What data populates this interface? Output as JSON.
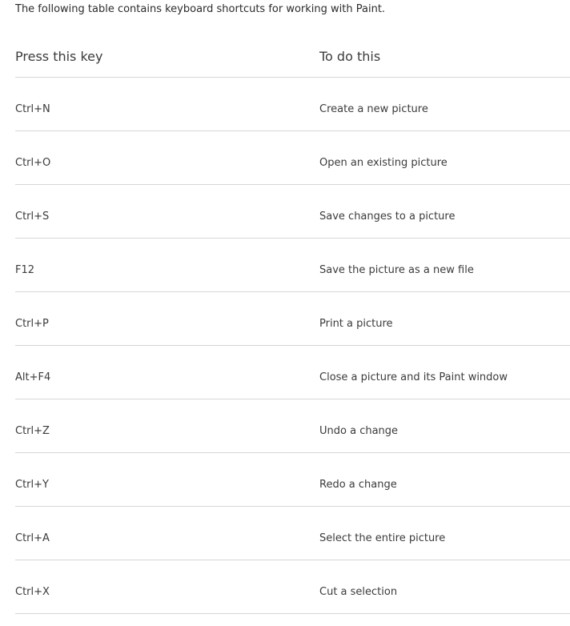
{
  "intro": "The following table contains keyboard shortcuts for working with Paint.",
  "table": {
    "headers": {
      "key": "Press this key",
      "action": "To do this"
    },
    "rows": [
      {
        "key": "Ctrl+N",
        "action": "Create a new picture"
      },
      {
        "key": "Ctrl+O",
        "action": "Open an existing picture"
      },
      {
        "key": "Ctrl+S",
        "action": "Save changes to a picture"
      },
      {
        "key": "F12",
        "action": "Save the picture as a new file"
      },
      {
        "key": "Ctrl+P",
        "action": "Print a picture"
      },
      {
        "key": "Alt+F4",
        "action": "Close a picture and its Paint window"
      },
      {
        "key": "Ctrl+Z",
        "action": "Undo a change"
      },
      {
        "key": "Ctrl+Y",
        "action": "Redo a change"
      },
      {
        "key": "Ctrl+A",
        "action": "Select the entire picture"
      },
      {
        "key": "Ctrl+X",
        "action": "Cut a selection"
      }
    ]
  }
}
